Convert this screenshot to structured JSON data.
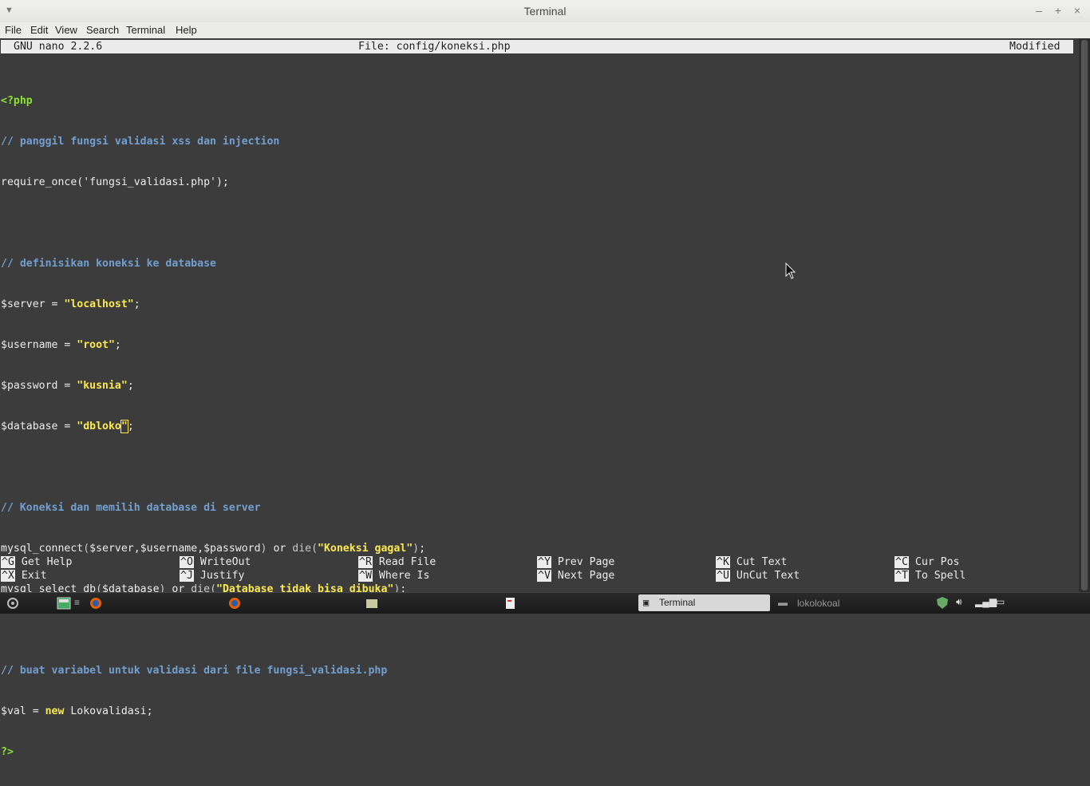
{
  "window": {
    "title": "Terminal"
  },
  "menu": [
    "File",
    "Edit",
    "View",
    "Search",
    "Terminal",
    "Help"
  ],
  "nano": {
    "version": "GNU nano 2.2.6",
    "file": "File: config/koneksi.php",
    "status": "Modified"
  },
  "code": [
    "<?php",
    "// panggil fungsi validasi xss dan injection",
    "require_once('fungsi_validasi.php');",
    "",
    "// definisikan koneksi ke database",
    "$server = \"localhost\";",
    "$username = \"root\";",
    "$password = \"kusnia\";",
    "$database = \"dbloko\";",
    "",
    "// Koneksi dan memilih database di server",
    "mysql_connect($server,$username,$password) or die(\"Koneksi gagal\");",
    "mysql_select_db($database) or die(\"Database tidak bisa dibuka\");",
    "",
    "// buat variabel untuk validasi dari file fungsi_validasi.php",
    "$val = new Lokovalidasi;",
    "?>"
  ],
  "shortcuts": [
    {
      "key": "^G",
      "label": "Get Help"
    },
    {
      "key": "^O",
      "label": "WriteOut"
    },
    {
      "key": "^R",
      "label": "Read File"
    },
    {
      "key": "^Y",
      "label": "Prev Page"
    },
    {
      "key": "^K",
      "label": "Cut Text"
    },
    {
      "key": "^C",
      "label": "Cur Pos"
    },
    {
      "key": "^X",
      "label": "Exit"
    },
    {
      "key": "^J",
      "label": "Justify"
    },
    {
      "key": "^W",
      "label": "Where Is"
    },
    {
      "key": "^V",
      "label": "Next Page"
    },
    {
      "key": "^U",
      "label": "UnCut Text"
    },
    {
      "key": "^T",
      "label": "To Spell"
    }
  ],
  "taskbar": {
    "active_task": "Terminal",
    "other_task": "lokolokoal"
  },
  "colors": {
    "terminal_bg": "#3c3c3c",
    "php_tag": "#8ae234",
    "comment": "#729fcf",
    "string": "#fce94f"
  }
}
